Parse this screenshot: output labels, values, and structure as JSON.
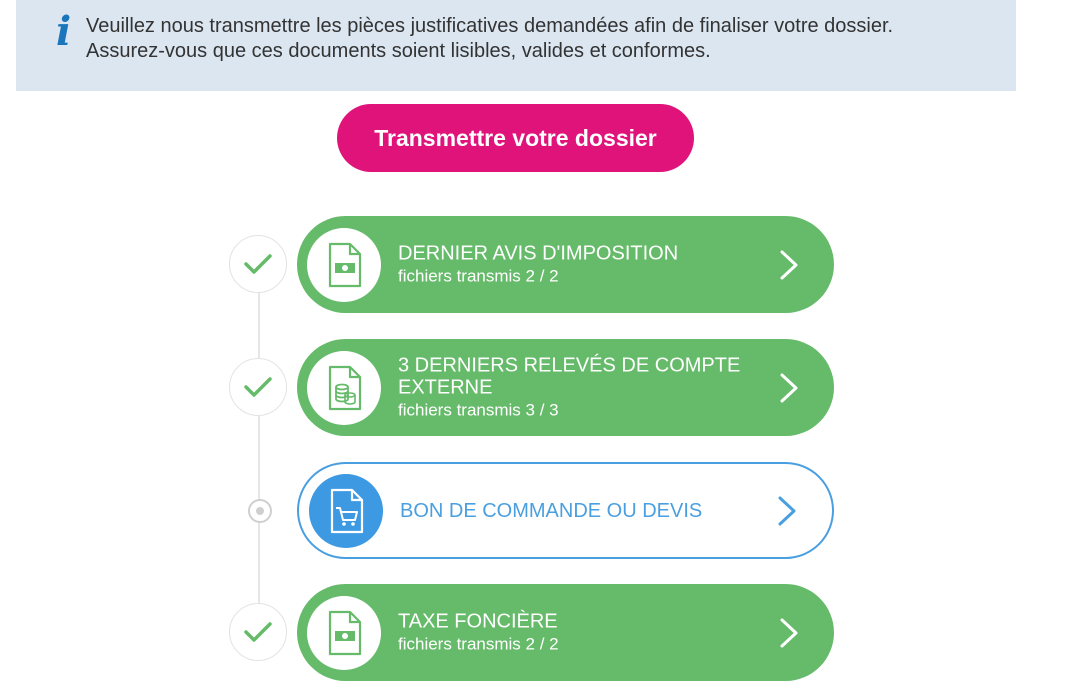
{
  "info": {
    "line1": "Veuillez nous transmettre les pièces justificatives demandées afin de finaliser votre dossier.",
    "line2": "Assurez-vous que ces documents soient lisibles, valides et conformes.",
    "icon": "info-icon"
  },
  "cta": {
    "label": "Transmettre votre dossier"
  },
  "colors": {
    "done_green": "#66bb6a",
    "pending_blue": "#4a9fe0",
    "cta_pink": "#e0137a",
    "banner_bg": "#dbe6f1"
  },
  "documents": [
    {
      "title": "DERNIER AVIS D'IMPOSITION",
      "subtitle": "fichiers transmis 2 / 2",
      "status": "done",
      "icon": "tax-document-icon"
    },
    {
      "title": "3 DERNIERS RELEVÉS DE COMPTE EXTERNE",
      "subtitle": "fichiers transmis 3 / 3",
      "status": "done",
      "icon": "bank-statement-icon"
    },
    {
      "title": "BON DE COMMANDE OU DEVIS",
      "subtitle": "",
      "status": "pending",
      "icon": "cart-document-icon"
    },
    {
      "title": "TAXE FONCIÈRE",
      "subtitle": "fichiers transmis 2 / 2",
      "status": "done",
      "icon": "tax-document-icon"
    }
  ]
}
